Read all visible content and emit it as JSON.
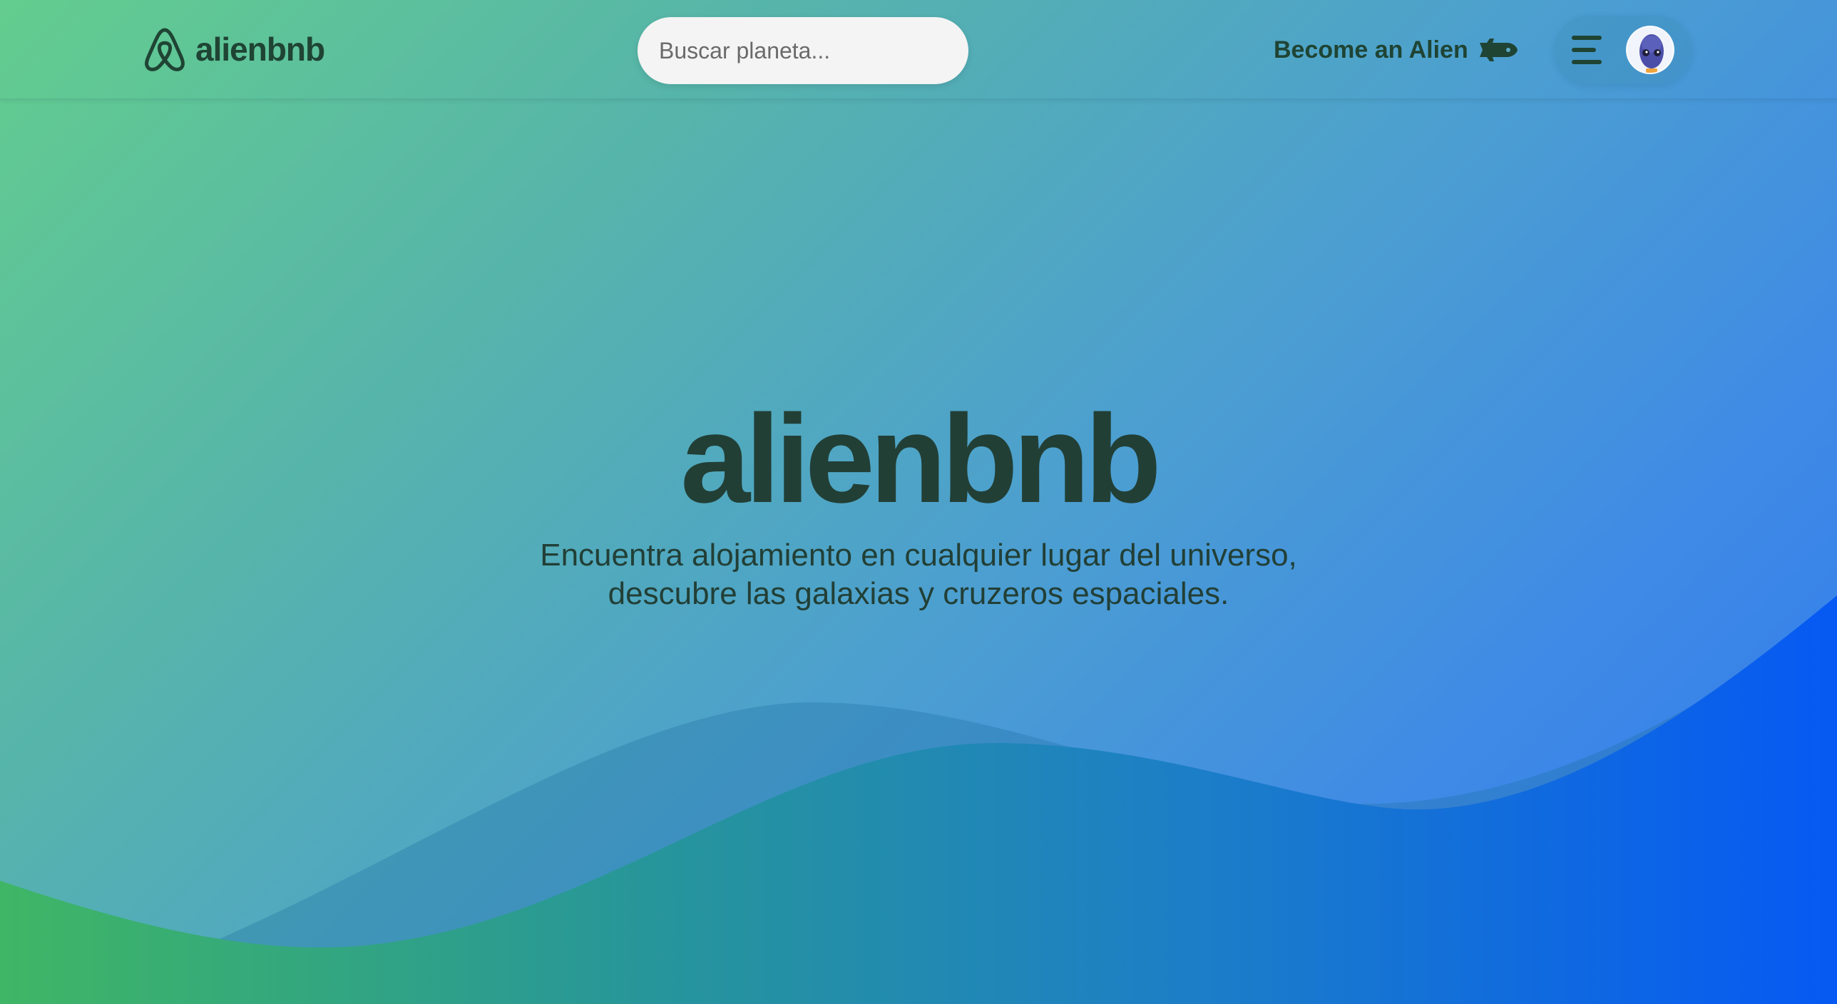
{
  "header": {
    "brand": "alienbnb",
    "search_placeholder": "Buscar planeta...",
    "become_label": "Become an Alien",
    "menu_icon": "hamburger-icon",
    "avatar_icon": "alien-avatar"
  },
  "hero": {
    "title": "alienbnb",
    "subtitle_line1": "Encuentra alojamiento en cualquier lugar del universo,",
    "subtitle_line2": "descubre las galaxias y cruzeros espaciales."
  },
  "colors": {
    "text_dark": "#1f4434",
    "gradient_start": "#63cd8e",
    "gradient_end": "#2d78ec",
    "wave_green": "#3eb562",
    "wave_blue": "#0559f3"
  }
}
